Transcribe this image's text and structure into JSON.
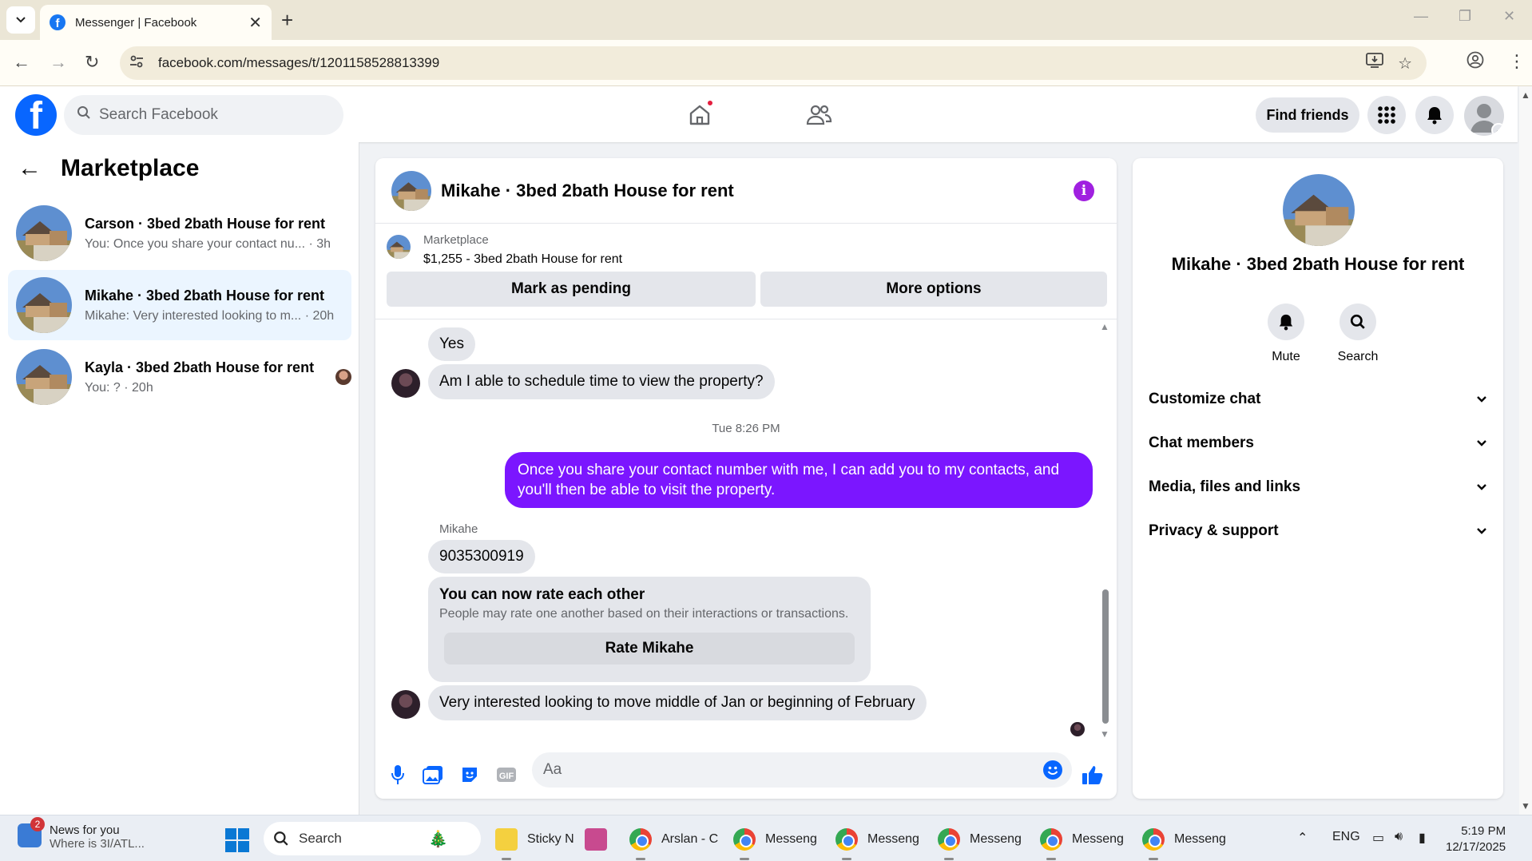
{
  "browser": {
    "tab_title": "Messenger | Facebook",
    "url": "facebook.com/messages/t/1201158528813399"
  },
  "fb_header": {
    "search_placeholder": "Search Facebook",
    "find_friends": "Find friends"
  },
  "left": {
    "title": "Marketplace",
    "conversations": [
      {
        "name": "Carson · 3bed 2bath House for rent",
        "preview": "You: Once you share your contact nu...",
        "time": "· 3h"
      },
      {
        "name": "Mikahe · 3bed 2bath House for rent",
        "preview": "Mikahe: Very interested looking to m...",
        "time": "· 20h"
      },
      {
        "name": "Kayla · 3bed 2bath House for rent",
        "preview": "You: ?",
        "time": "· 20h"
      }
    ]
  },
  "chat": {
    "title": "Mikahe · 3bed 2bath House for rent",
    "marketplace_label": "Marketplace",
    "listing": "$1,255 - 3bed 2bath House for rent",
    "mark_pending": "Mark as pending",
    "more_options": "More options",
    "messages": {
      "m1": "Yes",
      "m2": "Am I able to schedule time to view the property?",
      "timestamp": "Tue 8:26 PM",
      "m3": "Once you share your contact number with me, I can add you to my contacts, and you'll then be able to visit the property.",
      "sender": "Mikahe",
      "m4": "9035300919",
      "m5": "Very interested looking to move middle of Jan or beginning of February"
    },
    "rating": {
      "title": "You can now rate each other",
      "desc": "People may rate one another based on their interactions or transactions.",
      "button": "Rate Mikahe"
    },
    "composer_placeholder": "Aa",
    "gif_label": "GIF"
  },
  "right": {
    "name": "Mikahe · 3bed 2bath House for rent",
    "mute": "Mute",
    "search": "Search",
    "sections": [
      "Customize chat",
      "Chat members",
      "Media, files and links",
      "Privacy & support"
    ]
  },
  "taskbar": {
    "news_title": "News for you",
    "news_sub": "Where is 3I/ATL...",
    "news_badge": "2",
    "search": "Search",
    "apps": [
      "Sticky N",
      "Arslan - C",
      "Messeng",
      "Messeng",
      "Messeng",
      "Messeng",
      "Messeng"
    ],
    "lang": "ENG",
    "time": "5:19 PM",
    "date": "12/17/2025"
  },
  "colors": {
    "fb_blue": "#0866ff",
    "my_bubble": "#7b16ff",
    "info_purple": "#a020e0",
    "active_row": "#ebf5ff"
  }
}
